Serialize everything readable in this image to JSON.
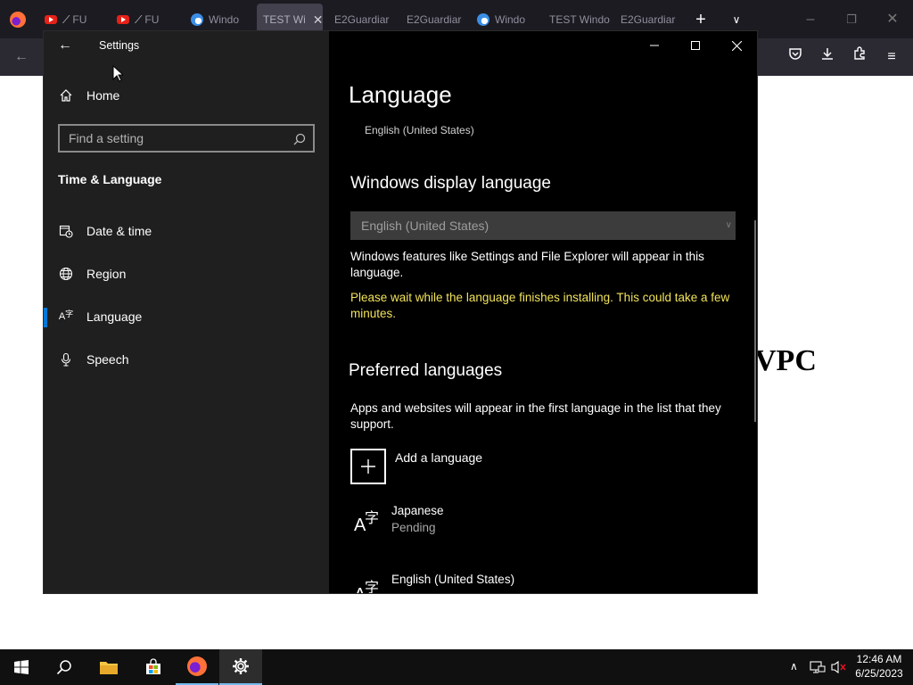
{
  "browser": {
    "tabs": [
      {
        "label": "FU",
        "favicon": "youtube-icon"
      },
      {
        "label": "FU",
        "favicon": "youtube-icon"
      },
      {
        "label": "Windo",
        "favicon": "edge-icon"
      },
      {
        "label": "TEST Wi",
        "favicon": "",
        "active": true
      },
      {
        "label": "E2Guardiar",
        "favicon": ""
      },
      {
        "label": "E2Guardiar",
        "favicon": ""
      },
      {
        "label": "Windo",
        "favicon": "edge-icon"
      },
      {
        "label": "TEST Windo",
        "favicon": ""
      },
      {
        "label": "E2Guardiar",
        "favicon": ""
      }
    ],
    "page_heading": "VPC"
  },
  "settings": {
    "window_title": "Settings",
    "home_label": "Home",
    "search_placeholder": "Find a setting",
    "section_title": "Time & Language",
    "nav": [
      {
        "label": "Date & time",
        "icon": "calendar-clock-icon"
      },
      {
        "label": "Region",
        "icon": "globe-icon"
      },
      {
        "label": "Language",
        "icon": "language-icon",
        "selected": true
      },
      {
        "label": "Speech",
        "icon": "microphone-icon"
      }
    ],
    "main": {
      "page_title": "Language",
      "current_language": "English (United States)",
      "display_language_heading": "Windows display language",
      "display_language_value": "English (United States)",
      "display_language_desc": "Windows features like Settings and File Explorer will appear in this language.",
      "install_warning": "Please wait while the language finishes installing. This could take a few minutes.",
      "preferred_heading": "Preferred languages",
      "preferred_desc": "Apps and websites will appear in the first language in the list that they support.",
      "add_language_label": "Add a language",
      "languages": [
        {
          "name": "Japanese",
          "status": "Pending"
        },
        {
          "name": "English (United States)",
          "status": ""
        }
      ]
    }
  },
  "taskbar": {
    "time": "12:46 AM",
    "date": "6/25/2023"
  },
  "colors": {
    "accent": "#0078d7",
    "warning": "#f2e35a"
  }
}
